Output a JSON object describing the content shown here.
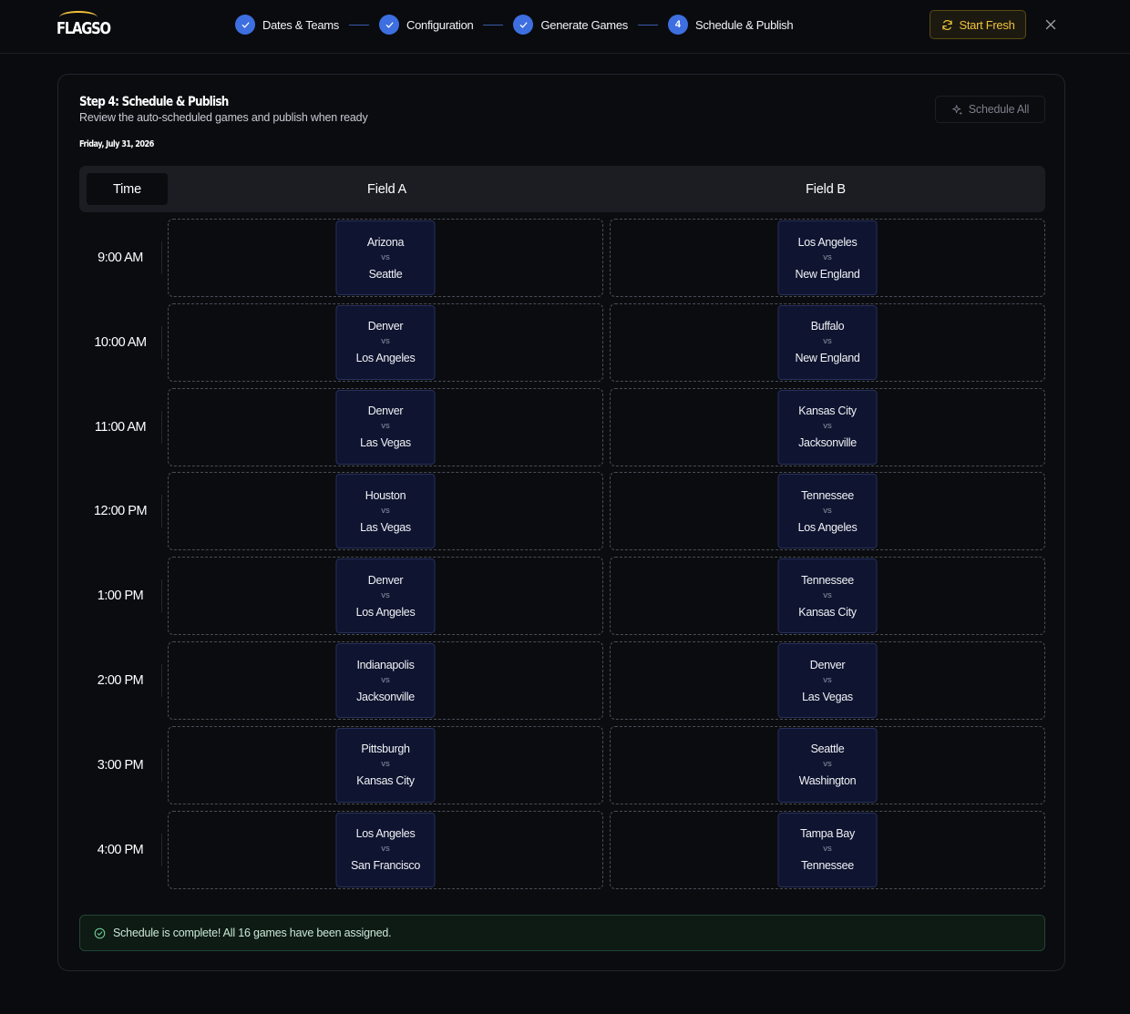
{
  "app": {
    "logo_text": "FLAGSO",
    "accent": "#f0c23a",
    "primary": "#3d6fe0"
  },
  "stepper": [
    {
      "label": "Dates & Teams",
      "state": "complete",
      "icon": "check-icon"
    },
    {
      "label": "Configuration",
      "state": "complete",
      "icon": "check-icon"
    },
    {
      "label": "Generate Games",
      "state": "complete",
      "icon": "check-icon"
    },
    {
      "label": "Schedule & Publish",
      "state": "current",
      "number": "4"
    }
  ],
  "header": {
    "start_fresh_label": "Start Fresh",
    "start_fresh_icon": "refresh-icon",
    "close_icon": "close-icon"
  },
  "card": {
    "title": "Step 4: Schedule & Publish",
    "subtitle": "Review the auto-scheduled games and publish when ready",
    "date": "Friday, July 31, 2026",
    "schedule_all_label": "Schedule All",
    "schedule_all_icon": "sparkle-icon"
  },
  "grid": {
    "time_header": "Time",
    "fields": [
      "Field A",
      "Field B"
    ],
    "vs_label": "vs",
    "rows": [
      {
        "time": "9:00 AM",
        "games": [
          [
            "Arizona",
            "Seattle"
          ],
          [
            "Los Angeles",
            "New England"
          ]
        ]
      },
      {
        "time": "10:00 AM",
        "games": [
          [
            "Denver",
            "Los Angeles"
          ],
          [
            "Buffalo",
            "New England"
          ]
        ]
      },
      {
        "time": "11:00 AM",
        "games": [
          [
            "Denver",
            "Las Vegas"
          ],
          [
            "Kansas City",
            "Jacksonville"
          ]
        ]
      },
      {
        "time": "12:00 PM",
        "games": [
          [
            "Houston",
            "Las Vegas"
          ],
          [
            "Tennessee",
            "Los Angeles"
          ]
        ]
      },
      {
        "time": "1:00 PM",
        "games": [
          [
            "Denver",
            "Los Angeles"
          ],
          [
            "Tennessee",
            "Kansas City"
          ]
        ]
      },
      {
        "time": "2:00 PM",
        "games": [
          [
            "Indianapolis",
            "Jacksonville"
          ],
          [
            "Denver",
            "Las Vegas"
          ]
        ]
      },
      {
        "time": "3:00 PM",
        "games": [
          [
            "Pittsburgh",
            "Kansas City"
          ],
          [
            "Seattle",
            "Washington"
          ]
        ]
      },
      {
        "time": "4:00 PM",
        "games": [
          [
            "Los Angeles",
            "San Francisco"
          ],
          [
            "Tampa Bay",
            "Tennessee"
          ]
        ]
      }
    ]
  },
  "status": {
    "message": "Schedule is complete! All 16 games have been assigned.",
    "icon": "check-circle-icon"
  }
}
